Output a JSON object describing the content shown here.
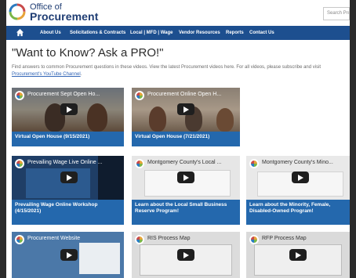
{
  "header": {
    "logo_line1": "Office of",
    "logo_line2": "Procurement",
    "search_placeholder": "Search Procu"
  },
  "nav": {
    "items": [
      "About Us",
      "Solicitations & Contracts",
      "Local | MFD | Wage",
      "Vendor Resources",
      "Reports",
      "Contact Us"
    ]
  },
  "page": {
    "title": "\"Want to Know? Ask a PRO!\"",
    "intro": "Find answers to common Procurement questions in these videos. View the latest Procurement videos here. For all videos, please subscribe and visit ",
    "intro_link": "Procurement's YouTube Channel",
    "intro_end": "."
  },
  "videos": [
    {
      "overlay": "Procurement Sept Open Ho...",
      "caption": "Virtual Open House (9/15/2021)"
    },
    {
      "overlay": "Procurement Online Open H...",
      "caption": "Virtual Open House (7/21/2021)"
    },
    {
      "overlay": "Prevailing Wage Live Online ...",
      "caption": "Prevailing Wage Online Workshop (4/15/2021)"
    },
    {
      "overlay": "Montgomery County's Local ...",
      "caption": "Learn about the Local Small Business Reserve Program!"
    },
    {
      "overlay": "Montgomery County's Mino...",
      "caption": "Learn about the Minority, Female, Disabled-Owned Program!"
    },
    {
      "overlay": "Procurement Website",
      "caption": ""
    },
    {
      "overlay": "RIS Process Map",
      "caption": ""
    },
    {
      "overlay": "RFP Process Map",
      "caption": ""
    }
  ],
  "colors": {
    "nav": "#1d4f8f",
    "caption": "#2468ad"
  }
}
